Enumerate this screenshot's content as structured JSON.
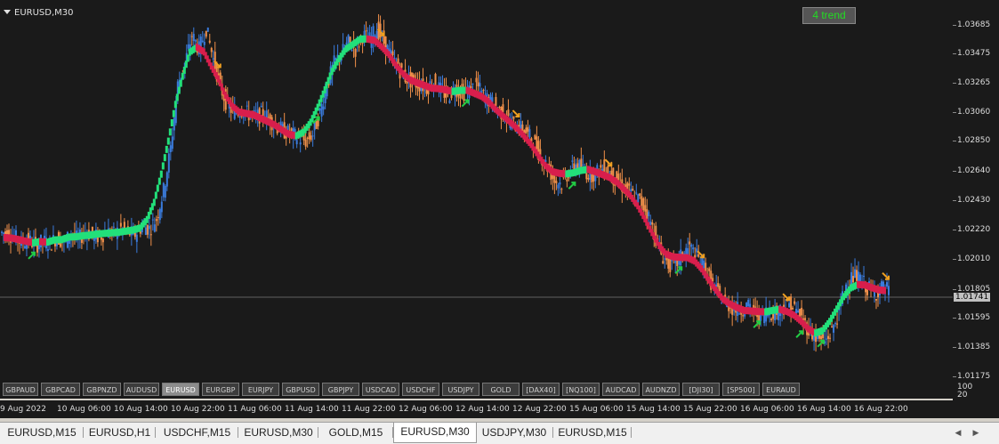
{
  "chart": {
    "symbol_label": "EURUSD,M30",
    "trend_label": "4 trend",
    "current_price": "1.01741"
  },
  "price_axis": {
    "ticks": [
      "1.03685",
      "1.03475",
      "1.03265",
      "1.03060",
      "1.02850",
      "1.02640",
      "1.02430",
      "1.02220",
      "1.02010",
      "1.01805",
      "1.01595",
      "1.01385",
      "1.01175"
    ]
  },
  "sub_axis": {
    "top": "100",
    "bottom": "20"
  },
  "time_axis": {
    "labels": [
      "9 Aug 2022",
      "10 Aug 06:00",
      "10 Aug 14:00",
      "10 Aug 22:00",
      "11 Aug 06:00",
      "11 Aug 14:00",
      "11 Aug 22:00",
      "12 Aug 06:00",
      "12 Aug 14:00",
      "12 Aug 22:00",
      "15 Aug 06:00",
      "15 Aug 14:00",
      "15 Aug 22:00",
      "16 Aug 06:00",
      "16 Aug 14:00",
      "16 Aug 22:00"
    ]
  },
  "symbol_buttons": [
    "GBPAUD",
    "GBPCAD",
    "GBPNZD",
    "AUDUSD",
    "EURUSD",
    "EURGBP",
    "EURJPY",
    "GBPUSD",
    "GBPJPY",
    "USDCAD",
    "USDCHF",
    "USDJPY",
    "GOLD",
    "[DAX40]",
    "[NQ100]",
    "AUDCAD",
    "AUDNZD",
    "[DJI30]",
    "[SP500]",
    "EURAUD"
  ],
  "active_symbol": "EURUSD",
  "tabs": [
    "EURUSD,M15",
    "EURUSD,H1",
    "USDCHF,M15",
    "EURUSD,M30",
    "GOLD,M15",
    "EURUSD,M30",
    "USDJPY,M30",
    "EURUSD,M15"
  ],
  "active_tab_index": 5,
  "colors": {
    "background": "#1a1a1a",
    "bull_candle": "#3a7bdc",
    "bear_candle": "#f0904a",
    "trend_up": "#22e07a",
    "trend_down": "#d81e4c",
    "buy_arrow": "#22cc44",
    "sell_arrow": "#f0a020"
  },
  "chart_data": {
    "type": "candlestick",
    "price_range": [
      1.0112,
      1.0375
    ],
    "closes": [
      1.0215,
      1.0212,
      1.0208,
      1.021,
      1.0206,
      1.0209,
      1.0207,
      1.0212,
      1.0208,
      1.0214,
      1.021,
      1.0216,
      1.0213,
      1.0212,
      1.0216,
      1.0214,
      1.0218,
      1.0215,
      1.0214,
      1.022,
      1.0218,
      1.0225,
      1.0245,
      1.0275,
      1.032,
      1.0335,
      1.0355,
      1.0345,
      1.036,
      1.0338,
      1.0318,
      1.0305,
      1.03,
      1.0302,
      1.0299,
      1.0297,
      1.03,
      1.0295,
      1.029,
      1.0287,
      1.0285,
      1.0282,
      1.028,
      1.0285,
      1.03,
      1.032,
      1.0335,
      1.0342,
      1.035,
      1.0345,
      1.0355,
      1.0352,
      1.036,
      1.035,
      1.034,
      1.0332,
      1.0325,
      1.0322,
      1.032,
      1.0318,
      1.0322,
      1.0316,
      1.0312,
      1.0318,
      1.0314,
      1.0316,
      1.032,
      1.0312,
      1.0308,
      1.0303,
      1.0298,
      1.0292,
      1.029,
      1.0286,
      1.028,
      1.027,
      1.0262,
      1.0252,
      1.025,
      1.0258,
      1.0264,
      1.026,
      1.0256,
      1.0258,
      1.0262,
      1.0256,
      1.025,
      1.0246,
      1.0242,
      1.0238,
      1.023,
      1.0215,
      1.02,
      1.0193,
      1.0192,
      1.02,
      1.0205,
      1.0198,
      1.0192,
      1.018,
      1.0172,
      1.0166,
      1.0162,
      1.016,
      1.0163,
      1.0159,
      1.0156,
      1.016,
      1.0158,
      1.0162,
      1.0164,
      1.016,
      1.0152,
      1.0145,
      1.014,
      1.0138,
      1.0145,
      1.016,
      1.0178,
      1.0184,
      1.0182,
      1.0176,
      1.0172,
      1.0176,
      1.0174
    ]
  }
}
